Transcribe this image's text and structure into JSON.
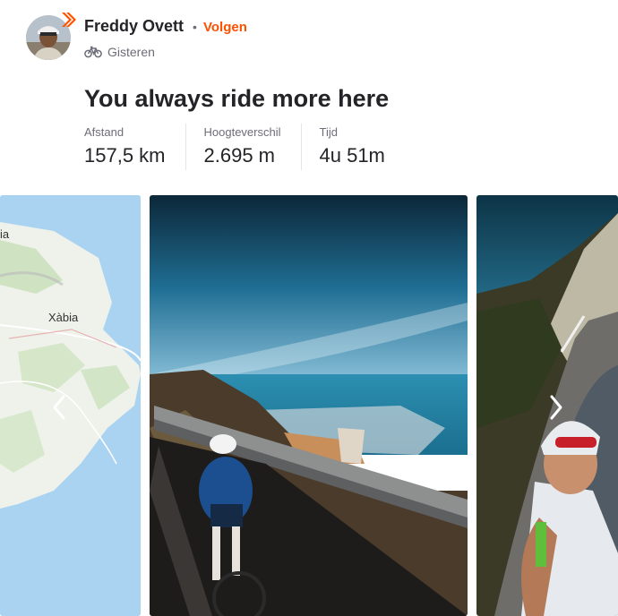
{
  "athlete": {
    "name": "Freddy Ovett",
    "separator": "•",
    "follow_label": "Volgen",
    "activity_icon": "bike-icon",
    "timestamp": "Gisteren"
  },
  "activity": {
    "title": "You always ride more here",
    "stats": [
      {
        "label": "Afstand",
        "value": "157,5 km"
      },
      {
        "label": "Hoogteverschil",
        "value": "2.695 m"
      },
      {
        "label": "Tijd",
        "value": "4u 51m"
      }
    ]
  },
  "map": {
    "labels": [
      "ia",
      "Xàbia"
    ]
  },
  "colors": {
    "brand": "#fc5200",
    "text": "#242428",
    "muted": "#6d6d78",
    "water": "#aad3f2",
    "land": "#e9efe4"
  },
  "gallery": {
    "prev_icon": "chevron-left-icon",
    "next_icon": "chevron-right-icon"
  }
}
